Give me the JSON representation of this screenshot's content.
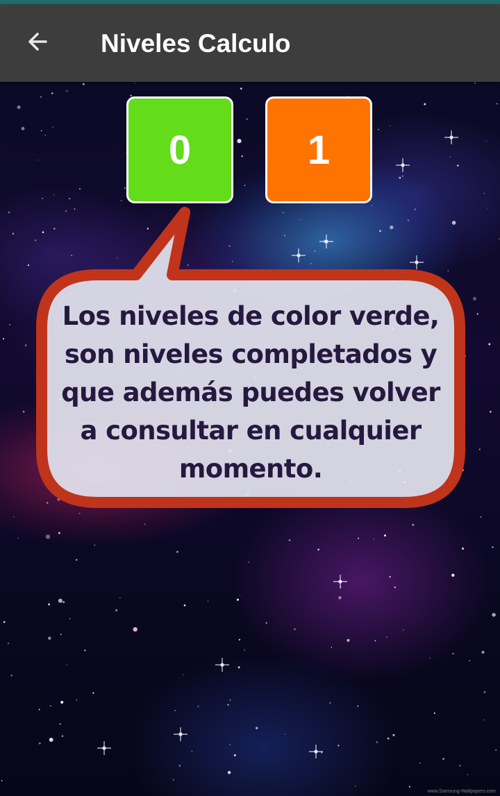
{
  "app_bar": {
    "title": "Niveles Calculo",
    "back_icon": "arrow-back-icon"
  },
  "levels": [
    {
      "label": "0",
      "status": "completed",
      "color": "#63dc1a"
    },
    {
      "label": "1",
      "status": "current",
      "color": "#ff7300"
    }
  ],
  "tooltip": {
    "text": "Los niveles de color verde, son niveles completados y que  además puedes volver a consultar en cualquier momento.",
    "border_color": "#c0341b",
    "fill_color": "#e3e3ee"
  },
  "background": {
    "watermark": "www.Samsung-Wallpapers.com"
  },
  "colors": {
    "app_bar": "#3d3d3d",
    "status_strip": "#1f6e6e"
  }
}
